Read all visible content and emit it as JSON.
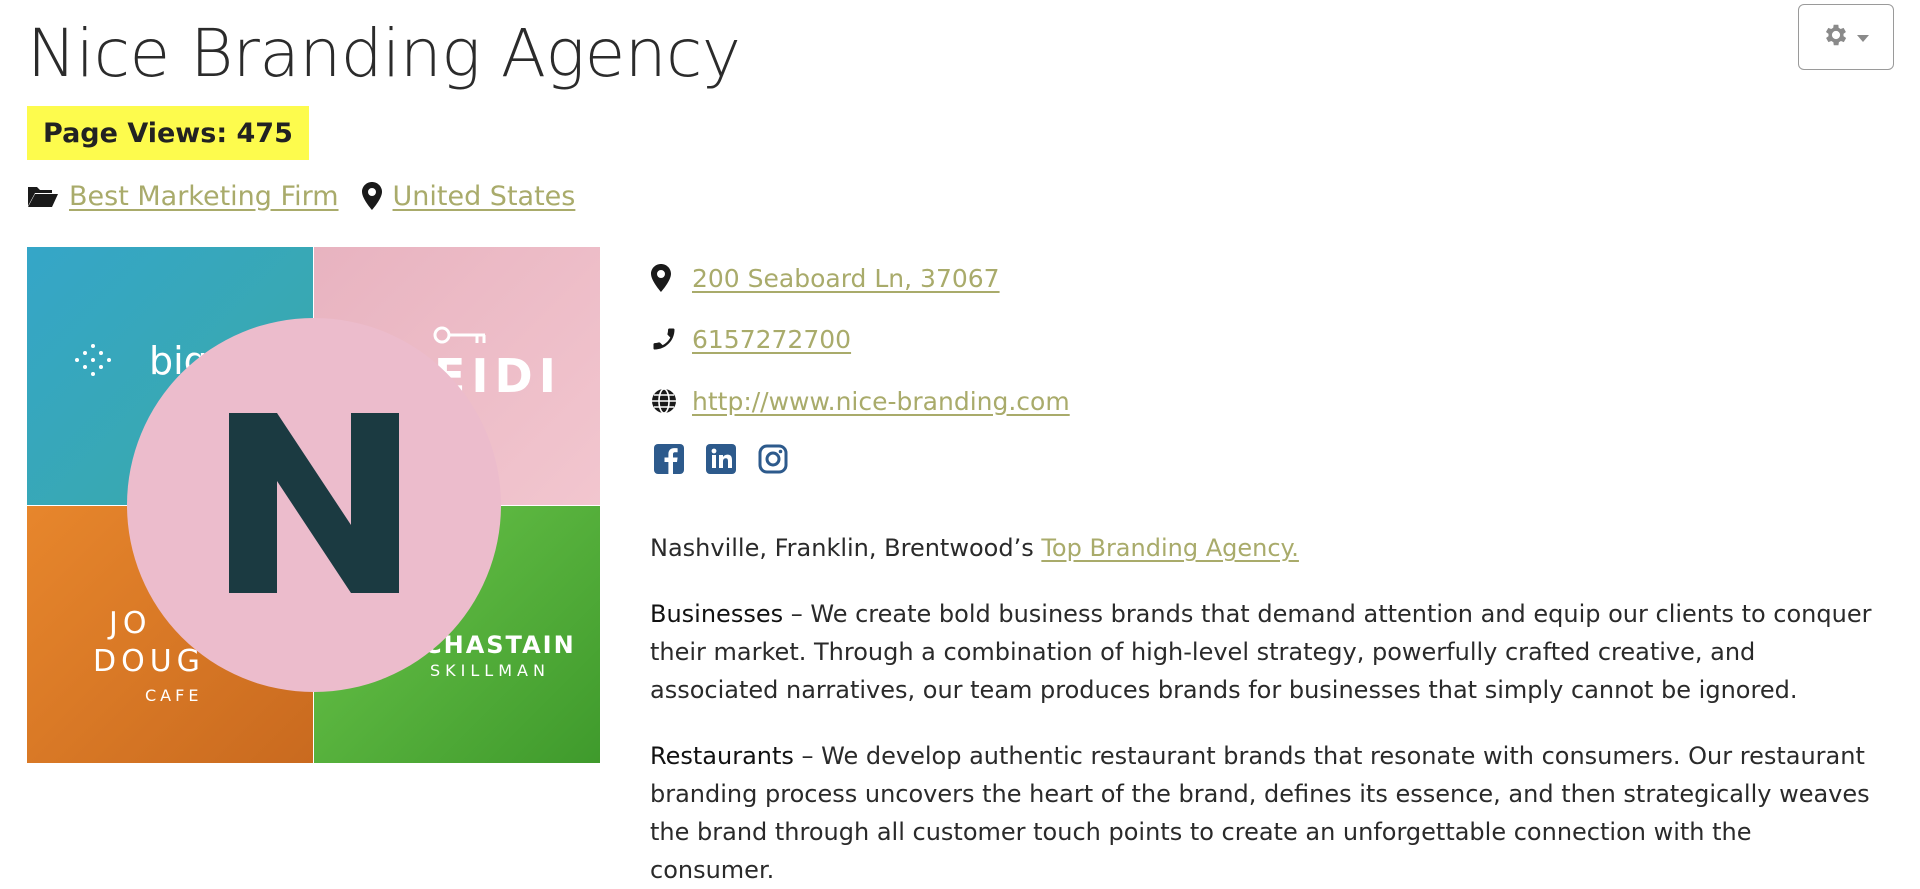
{
  "page": {
    "title": "Nice Branding Agency",
    "views_label": "Page Views: 475"
  },
  "meta": {
    "category": "Best Marketing Firm",
    "country": "United States"
  },
  "logo": {
    "letter": "N",
    "tiles": {
      "big": "big",
      "heidi": "EIDI",
      "jo": "JO",
      "dough": "DOUG",
      "cafe": "CAFE",
      "chastain": "CHASTAIN",
      "skillman": "SKILLMAN"
    }
  },
  "contact": {
    "address": "200 Seaboard Ln, 37067",
    "phone": "6157272700",
    "website": "http://www.nice-branding.com"
  },
  "social": [
    "facebook-icon",
    "linkedin-icon",
    "instagram-icon"
  ],
  "description": {
    "intro_text": "Nashville, Franklin, Brentwood’s ",
    "intro_link": "Top Branding Agency.",
    "businesses_label": "Businesses",
    "businesses_text": " – We create bold business brands that demand attention and equip our clients to conquer their market. Through a combination of high-level strategy, powerfully crafted creative, and associated narratives, our team produces brands for businesses that simply cannot be ignored.",
    "restaurants_label": "Restaurants",
    "restaurants_text": " – We develop authentic restaurant brands that resonate with consumers. Our restaurant branding process uncovers the heart of the brand, defines its essence, and then strategically weaves the brand through all customer touch points to create an unforgettable connection with the consumer."
  },
  "colors": {
    "link": "#a9ab6b",
    "highlight": "#fdfb4d",
    "logo_circle": "#ecbccc",
    "logo_letter": "#1b3a41"
  }
}
